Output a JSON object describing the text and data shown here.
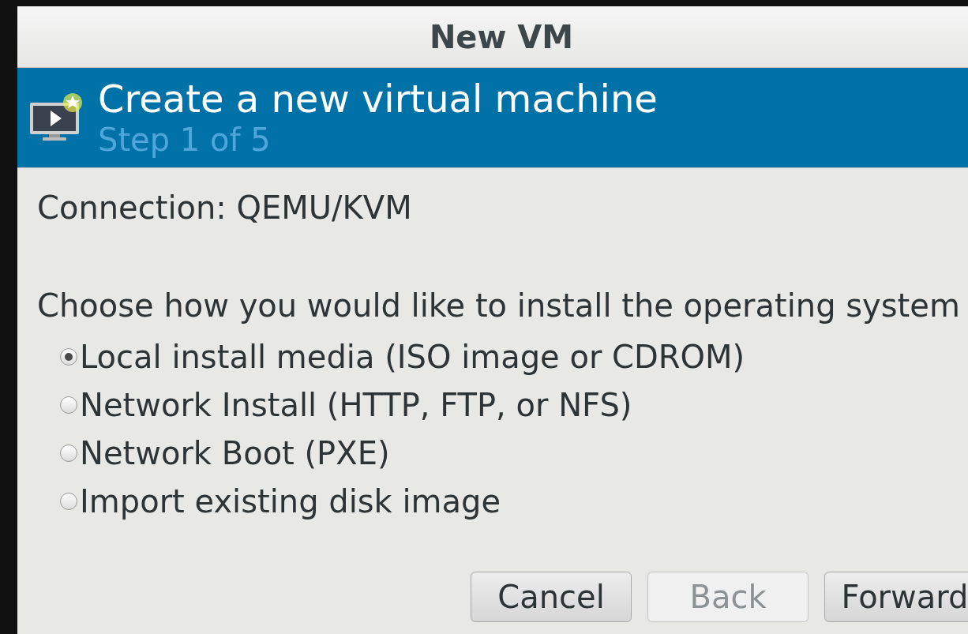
{
  "window": {
    "title": "New VM"
  },
  "header": {
    "title": "Create a new virtual machine",
    "step": "Step 1 of 5"
  },
  "connection": "Connection: QEMU/KVM",
  "prompt": "Choose how you would like to install the operating system",
  "options": [
    {
      "label": "Local install media (ISO image or CDROM)",
      "selected": true
    },
    {
      "label": "Network Install (HTTP, FTP, or NFS)",
      "selected": false
    },
    {
      "label": "Network Boot (PXE)",
      "selected": false
    },
    {
      "label": "Import existing disk image",
      "selected": false
    }
  ],
  "buttons": [
    {
      "label": "Cancel",
      "disabled": false
    },
    {
      "label": "Back",
      "disabled": true
    },
    {
      "label": "Forward",
      "disabled": false
    }
  ]
}
